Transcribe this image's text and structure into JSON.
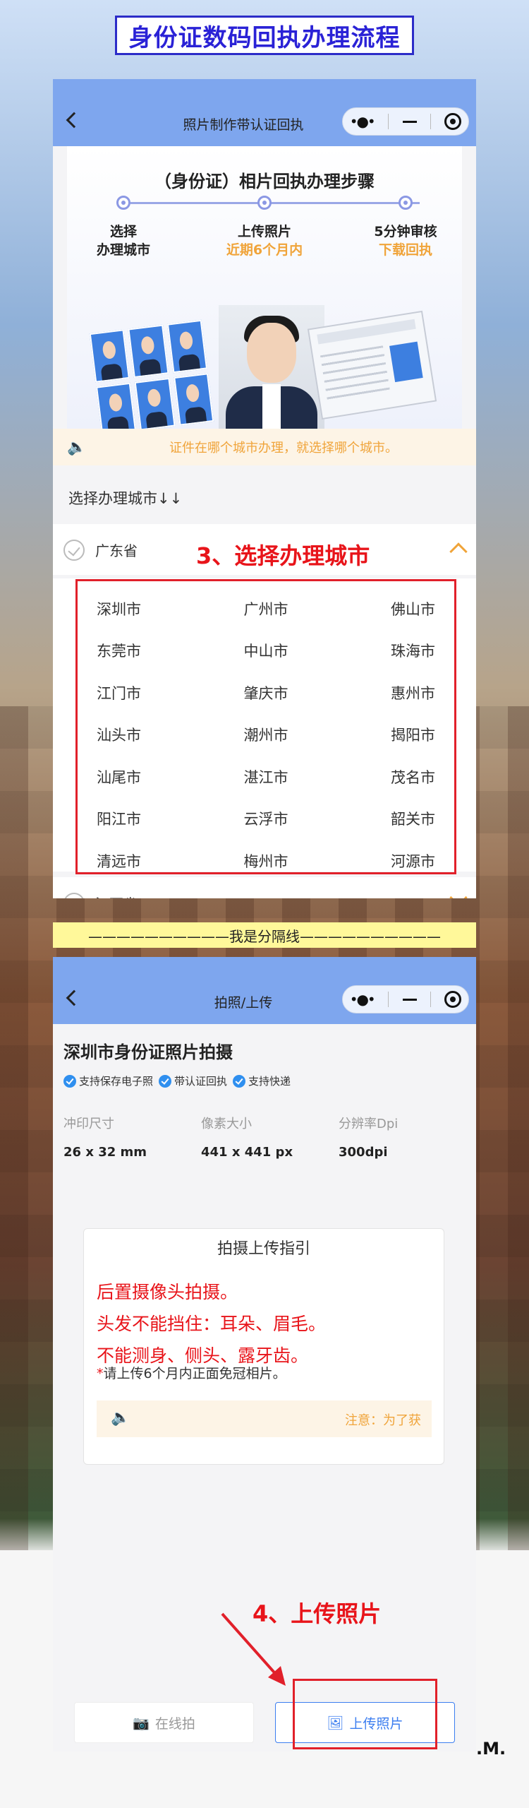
{
  "banner": "身份证数码回执办理流程",
  "phone1": {
    "nav_title": "照片制作带认证回执",
    "capsule": {
      "more": "•●•"
    },
    "steps_title": "（身份证）相片回执办理步骤",
    "steps": [
      {
        "line1": "选择",
        "line2": "办理城市"
      },
      {
        "line1": "上传照片",
        "line2": "近期6个月内"
      },
      {
        "line1": "5分钟审核",
        "line2": "下载回执"
      }
    ],
    "notice": "证件在哪个城市办理，就选择哪个城市。",
    "section_label": "选择办理城市↓↓",
    "province_open": "广东省",
    "province_next": "江西省",
    "cities": [
      "深圳市",
      "广州市",
      "佛山市",
      "东莞市",
      "中山市",
      "珠海市",
      "江门市",
      "肇庆市",
      "惠州市",
      "汕头市",
      "潮州市",
      "揭阳市",
      "汕尾市",
      "湛江市",
      "茂名市",
      "阳江市",
      "云浮市",
      "韶关市",
      "清远市",
      "梅州市",
      "河源市"
    ]
  },
  "annotations": {
    "step3": "3、选择办理城市",
    "step4": "4、上传照片"
  },
  "divider": "——————————我是分隔线——————————",
  "phone2": {
    "nav_title": "拍照/上传",
    "title": "深圳市身份证照片拍摄",
    "badges": [
      "支持保存电子照",
      "带认证回执",
      "支持快递"
    ],
    "specs": [
      {
        "k": "冲印尺寸",
        "v": "26 x 32 mm"
      },
      {
        "k": "像素大小",
        "v": "441 x 441 px"
      },
      {
        "k": "分辨率Dpi",
        "v": "300dpi"
      }
    ],
    "guide": {
      "title": "拍摄上传指引",
      "red_lines": [
        "后置摄像头拍摄。",
        "头发不能挡住：耳朵、眉毛。",
        "不能测身、侧头、露牙齿。"
      ],
      "note_star": "*",
      "note": "请上传6个月内正面免冠相片。",
      "notice": "注意：为了获"
    },
    "btn_online": "在线拍",
    "btn_upload": "上传照片"
  },
  "watermark": ".M.",
  "colors": {
    "nav": "#7ea6ee",
    "accent_orange": "#f0a43a",
    "red": "#e8141a",
    "blue": "#3c7ef0"
  }
}
